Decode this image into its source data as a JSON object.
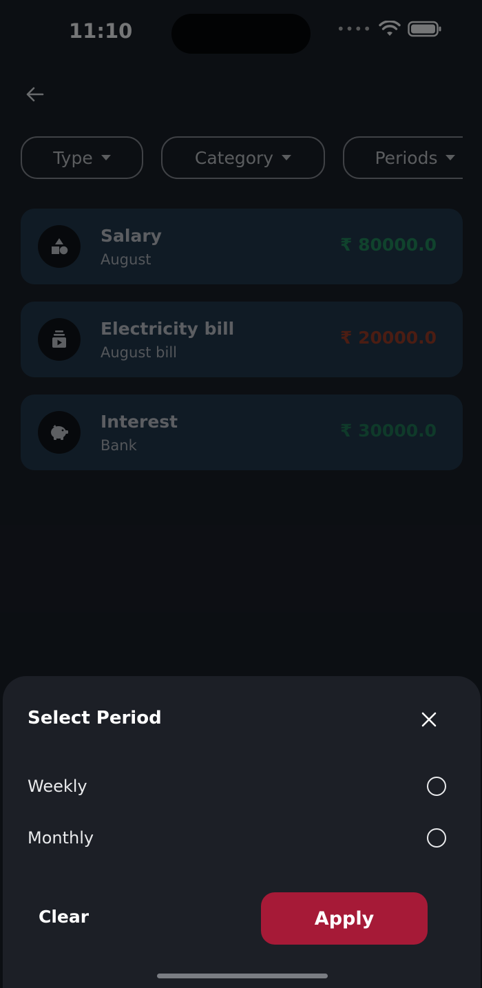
{
  "status_bar": {
    "time": "11:10"
  },
  "filters": [
    {
      "label": "Type"
    },
    {
      "label": "Category"
    },
    {
      "label": "Periods"
    }
  ],
  "transactions": [
    {
      "title": "Salary",
      "subtitle": "August",
      "amount": "₹ 80000.0",
      "amount_color": "#1f8f5b",
      "icon": "shapes-icon"
    },
    {
      "title": "Electricity bill",
      "subtitle": "August bill",
      "amount": "₹ 20000.0",
      "amount_color": "#a23a22",
      "icon": "media-stack-icon"
    },
    {
      "title": "Interest",
      "subtitle": "Bank",
      "amount": "₹ 30000.0",
      "amount_color": "#1d7a54",
      "icon": "piggy-bank-icon"
    }
  ],
  "sheet": {
    "title": "Select Period",
    "options": [
      {
        "label": "Weekly",
        "selected": false
      },
      {
        "label": "Monthly",
        "selected": false
      }
    ],
    "clear_label": "Clear",
    "apply_label": "Apply"
  },
  "colors": {
    "background": "#171b22",
    "card": "#213649",
    "sheet": "#1c1f26",
    "apply": "#a61a37"
  }
}
